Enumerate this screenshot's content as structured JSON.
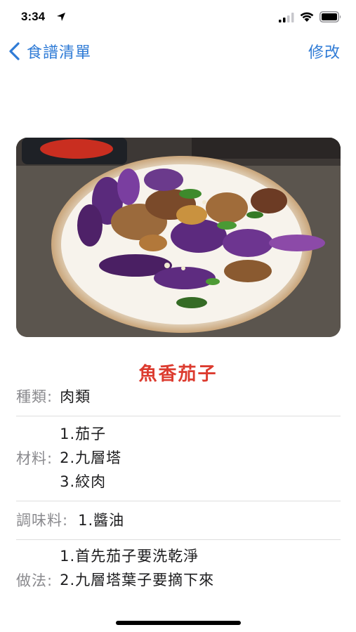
{
  "status_bar": {
    "time": "3:34"
  },
  "nav": {
    "back_label": "食譜清單",
    "edit_label": "修改"
  },
  "recipe": {
    "title": "魚香茄子",
    "category_label": "種類:",
    "category_value": "肉類",
    "ingredients_label": "材料:",
    "ingredients": [
      "1.茄子",
      "2.九層塔",
      "3.絞肉"
    ],
    "seasoning_label": "調味料:",
    "seasoning": [
      "1.醬油"
    ],
    "method_label": "做法:",
    "method": [
      "1.首先茄子要洗乾淨",
      "2.九層塔葉子要摘下來"
    ]
  },
  "colors": {
    "accent": "#2f7bd6",
    "title": "#dc3b2f",
    "label": "#8a8a8e"
  }
}
